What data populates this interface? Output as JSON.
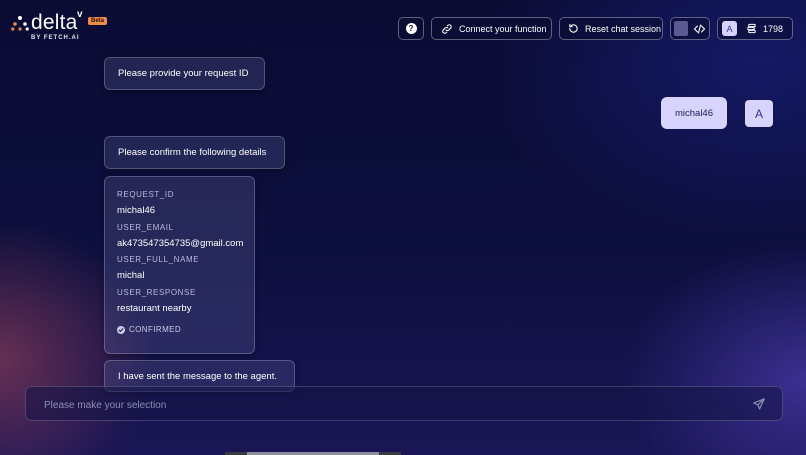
{
  "brand": {
    "name": "delta",
    "superscript": "v",
    "badge": "Beta",
    "byline": "BY FETCH.AI"
  },
  "toolbar": {
    "help_label": "?",
    "connect_label": "Connect your function",
    "reset_label": "Reset chat session",
    "user_initial": "A",
    "credits": "1798"
  },
  "chat": {
    "agent_messages": [
      "Please provide your request ID",
      "Please confirm the following details",
      "I have sent the message to the agent."
    ],
    "user_message": "michal46",
    "user_avatar_initial": "A",
    "details_card": {
      "fields": [
        {
          "key": "REQUEST_ID",
          "value": "michal46"
        },
        {
          "key": "USER_EMAIL",
          "value": "ak473547354735@gmail.com"
        },
        {
          "key": "USER_FULL_NAME",
          "value": "michal"
        },
        {
          "key": "USER_RESPONSE",
          "value": "restaurant nearby"
        }
      ],
      "status": "CONFIRMED"
    }
  },
  "input": {
    "placeholder": "Please make your selection"
  },
  "colors": {
    "background": "#0b0c34",
    "accent": "#d9d3ff",
    "badge": "#f08a4b"
  },
  "icons": {
    "help": "help-icon",
    "connect": "link-icon",
    "reset": "reset-icon",
    "code": "code-icon",
    "credits": "credits-icon",
    "send": "send-icon",
    "confirmed": "check-circle-icon"
  }
}
